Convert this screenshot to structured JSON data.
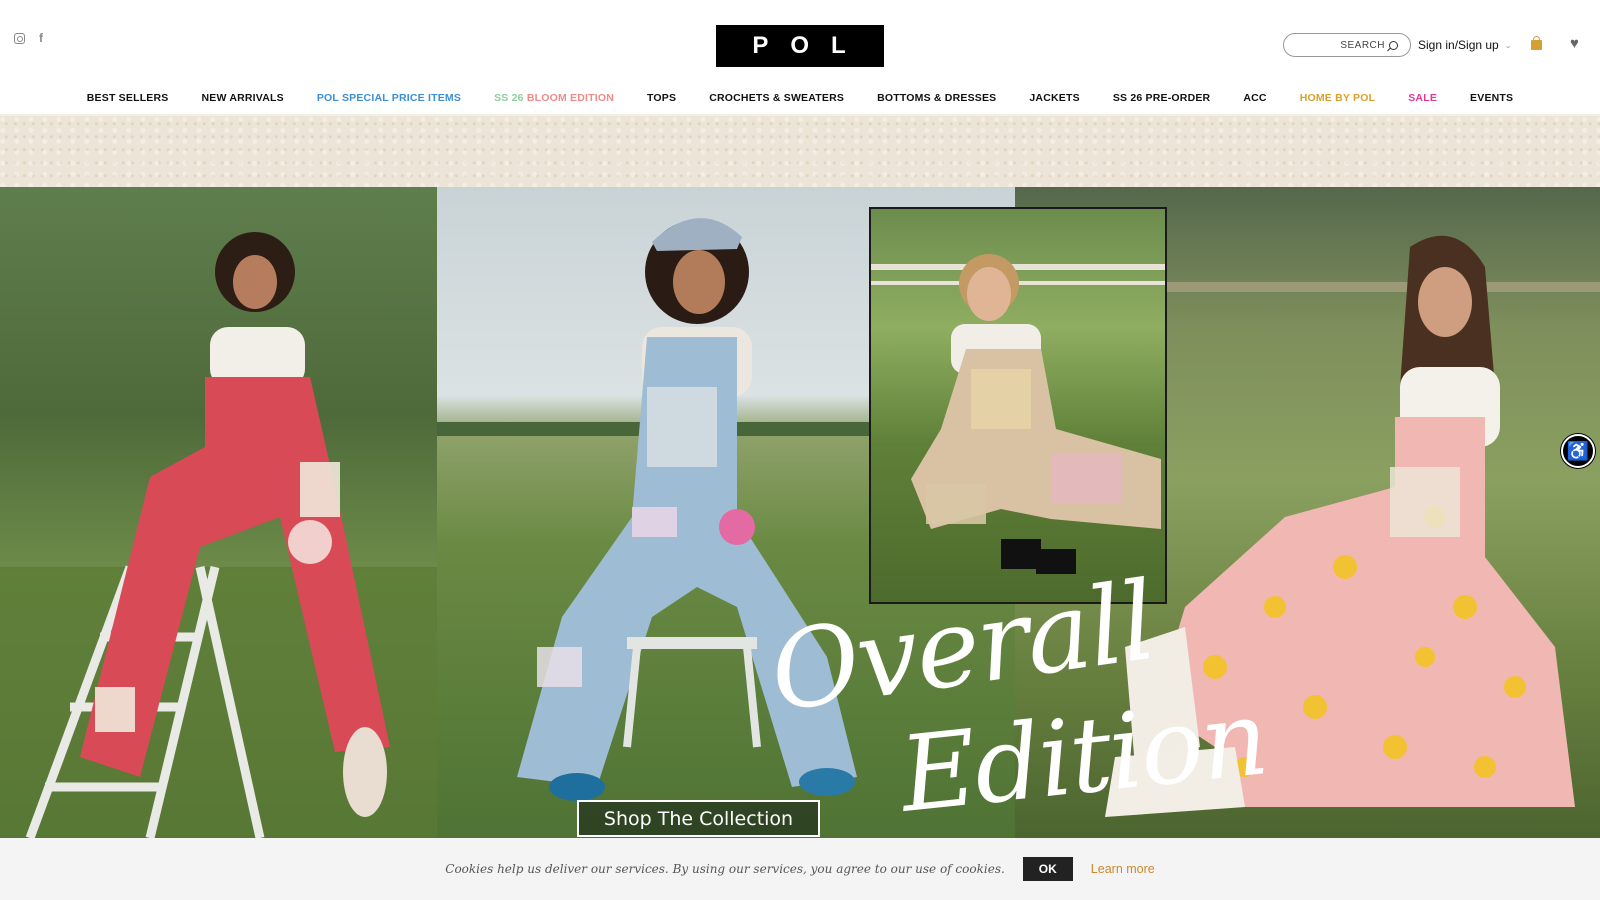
{
  "header": {
    "logo_text": "POL",
    "search_label": "SEARCH",
    "signin_label": "Sign in/Sign up",
    "icons": [
      "instagram-icon",
      "facebook-icon",
      "search-icon",
      "chevron-down-icon",
      "shopping-bag-icon",
      "heart-icon"
    ]
  },
  "nav": [
    {
      "label": "BEST SELLERS",
      "color": "#111111"
    },
    {
      "label": "NEW ARRIVALS",
      "color": "#111111"
    },
    {
      "label": "POL SPECIAL PRICE ITEMS",
      "color": "#3b8fd6"
    },
    {
      "label": "SS 26 BLOOM EDITION",
      "color": "#8fcf9b",
      "accent_color": "#f08a8a"
    },
    {
      "label": "TOPS",
      "color": "#111111"
    },
    {
      "label": "CROCHETS & SWEATERS",
      "color": "#111111"
    },
    {
      "label": "BOTTOMS & DRESSES",
      "color": "#111111"
    },
    {
      "label": "JACKETS",
      "color": "#111111"
    },
    {
      "label": "SS 26 PRE-ORDER",
      "color": "#111111"
    },
    {
      "label": "ACC",
      "color": "#111111"
    },
    {
      "label": "HOME BY POL",
      "color": "#d9a12b"
    },
    {
      "label": "SALE",
      "color": "#e0399a"
    },
    {
      "label": "EVENTS",
      "color": "#111111"
    }
  ],
  "hero": {
    "script_line1": "Overall",
    "script_line2": "Edition",
    "cta_label": "Shop The Collection"
  },
  "cookie": {
    "text": "Cookies help us deliver our services. By using our services, you agree to our use of cookies.",
    "ok_label": "OK",
    "learn_label": "Learn more"
  },
  "colors": {
    "accent_gold": "#d4a033",
    "learn_more": "#c88a2e"
  }
}
